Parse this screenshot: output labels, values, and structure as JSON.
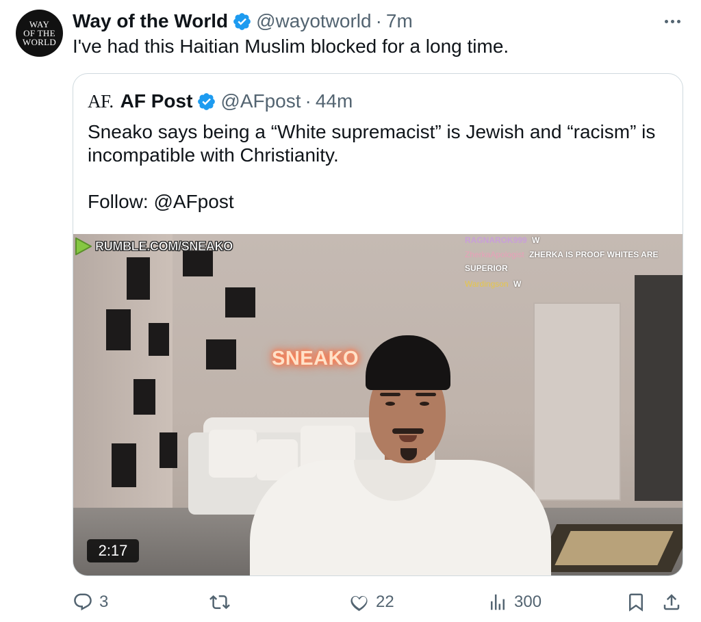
{
  "author": {
    "avatar_lines": [
      "WAY",
      "OF THE",
      "WORLD"
    ],
    "name": "Way of the World",
    "handle": "@wayotworld",
    "separator": "·",
    "time": "7m"
  },
  "tweet": {
    "text": "I've had this Haitian Muslim blocked for a long time."
  },
  "quoted": {
    "logo_text": "AF.",
    "name": "AF Post",
    "handle": "@AFpost",
    "separator": "·",
    "time": "44m",
    "text_line1": "Sneako says being a “White supremacist” is Jewish and “racism” is incompatible with Christianity.",
    "text_line2": "Follow: @AFpost",
    "video": {
      "watermark": "RUMBLE.COM/SNEAKO",
      "neon_sign": "SNEAKO",
      "duration": "2:17",
      "chat": [
        {
          "user": "RAGNAROK999",
          "message": "W"
        },
        {
          "user": "ZherkaApologist",
          "message": "ZHERKA IS PROOF WHITES ARE SUPERIOR"
        },
        {
          "user": "Wardingson",
          "message": "W"
        }
      ]
    }
  },
  "actions": {
    "replies": "3",
    "reposts": "",
    "likes": "22",
    "views": "300"
  },
  "colors": {
    "verified": "#1d9bf0",
    "muted": "#536471",
    "border": "#cfd9de",
    "rumble_green": "#85c742"
  },
  "icons": {
    "verified": "verified-badge-icon",
    "more": "more-dots-icon",
    "reply": "reply-icon",
    "repost": "repost-icon",
    "like": "like-heart-icon",
    "views": "views-chart-icon",
    "bookmark": "bookmark-icon",
    "share": "share-icon",
    "rumble": "rumble-play-icon"
  }
}
